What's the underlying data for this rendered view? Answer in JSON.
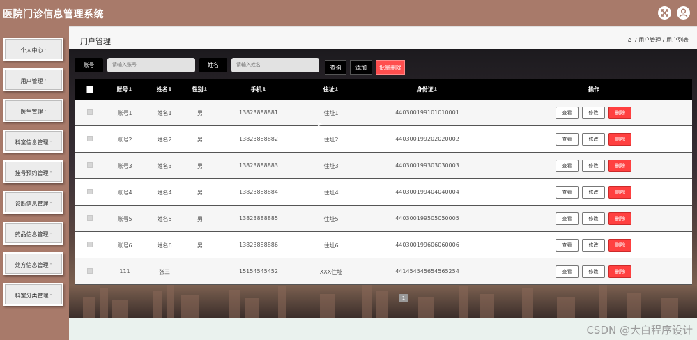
{
  "app": {
    "title": "医院门诊信息管理系统"
  },
  "header_icons": [
    "fullscreen-icon",
    "user-icon"
  ],
  "sidebar": {
    "items": [
      {
        "label": "个人中心"
      },
      {
        "label": "用户管理"
      },
      {
        "label": "医生管理"
      },
      {
        "label": "科室信息管理"
      },
      {
        "label": "挂号预约管理"
      },
      {
        "label": "诊断信息管理"
      },
      {
        "label": "药品信息管理"
      },
      {
        "label": "处方信息管理"
      },
      {
        "label": "科室分类管理"
      }
    ],
    "caret": "˅"
  },
  "page": {
    "title": "用户管理"
  },
  "breadcrumb": {
    "home_icon": "home-icon",
    "items": [
      "用户管理",
      "用户列表"
    ],
    "separator": "/"
  },
  "search": {
    "account_label": "账号",
    "account_placeholder": "请输入账号",
    "name_label": "姓名",
    "name_placeholder": "请输入姓名",
    "query_button": "查询",
    "add_button": "添加",
    "batch_delete_button": "批量删除"
  },
  "table": {
    "columns": [
      "账号",
      "姓名",
      "性别",
      "手机",
      "住址",
      "身份证",
      "操作"
    ],
    "sort_glyph": "⇕",
    "rows": [
      {
        "account": "账号1",
        "name": "姓名1",
        "gender": "男",
        "phone": "13823888881",
        "address": "住址1",
        "id_card": "440300199101010001"
      },
      {
        "account": "账号2",
        "name": "姓名2",
        "gender": "男",
        "phone": "13823888882",
        "address": "住址2",
        "id_card": "440300199202020002"
      },
      {
        "account": "账号3",
        "name": "姓名3",
        "gender": "男",
        "phone": "13823888883",
        "address": "住址3",
        "id_card": "440300199303030003"
      },
      {
        "account": "账号4",
        "name": "姓名4",
        "gender": "男",
        "phone": "13823888884",
        "address": "住址4",
        "id_card": "440300199404040004"
      },
      {
        "account": "账号5",
        "name": "姓名5",
        "gender": "男",
        "phone": "13823888885",
        "address": "住址5",
        "id_card": "440300199505050005"
      },
      {
        "account": "账号6",
        "name": "姓名6",
        "gender": "男",
        "phone": "13823888886",
        "address": "住址6",
        "id_card": "440300199606060006"
      },
      {
        "account": "111",
        "name": "张三",
        "gender": "",
        "phone": "15154545452",
        "address": "XXX住址",
        "id_card": "441454545654565254"
      }
    ],
    "actions": {
      "view": "查看",
      "edit": "修改",
      "delete": "删除"
    }
  },
  "pagination": {
    "current_page": "1"
  },
  "colors": {
    "brand": "#a87a6a",
    "danger": "#ff4040",
    "header_bg": "#000000"
  },
  "watermark": "CSDN @大白程序设计"
}
